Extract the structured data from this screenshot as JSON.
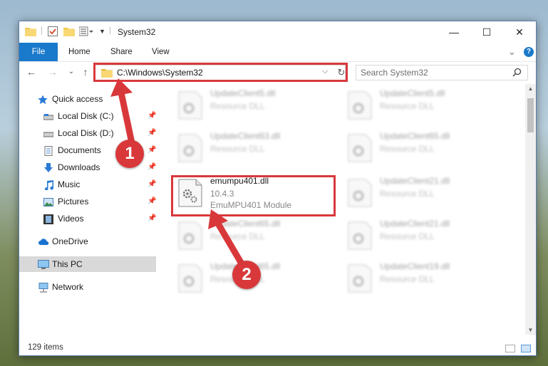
{
  "window": {
    "title": "System32",
    "controls": {
      "minimize": "—",
      "maximize": "☐",
      "close": "✕"
    }
  },
  "ribbon": {
    "tabs": [
      {
        "label": "File"
      },
      {
        "label": "Home"
      },
      {
        "label": "Share"
      },
      {
        "label": "View"
      }
    ],
    "expand_glyph": "⌄",
    "help_glyph": "?"
  },
  "nav": {
    "back": "←",
    "forward": "→",
    "recent": "⌄",
    "up": "↑",
    "address": "C:\\Windows\\System32",
    "address_drop": "⌵",
    "refresh": "↻",
    "search_placeholder": "Search System32"
  },
  "sidebar": {
    "items": [
      {
        "label": "Quick access",
        "icon": "star-icon",
        "pinned": false
      },
      {
        "label": "Local Disk (C:)",
        "icon": "drive-icon",
        "pinned": true
      },
      {
        "label": "Local Disk (D:)",
        "icon": "drive-icon",
        "pinned": true
      },
      {
        "label": "Documents",
        "icon": "documents-icon",
        "pinned": true
      },
      {
        "label": "Downloads",
        "icon": "download-arrow-icon",
        "pinned": true
      },
      {
        "label": "Music",
        "icon": "music-note-icon",
        "pinned": true
      },
      {
        "label": "Pictures",
        "icon": "pictures-icon",
        "pinned": true
      },
      {
        "label": "Videos",
        "icon": "film-icon",
        "pinned": true
      },
      {
        "label": "OneDrive",
        "icon": "cloud-icon",
        "pinned": false
      },
      {
        "label": "This PC",
        "icon": "computer-icon",
        "pinned": false,
        "selected": true
      },
      {
        "label": "Network",
        "icon": "network-icon",
        "pinned": false
      }
    ],
    "pin_glyph": "📌"
  },
  "files": [
    {
      "name": "UpdateClient5.dll",
      "type": "Resource DLL"
    },
    {
      "name": "UpdateClient5.dll",
      "type": "Resource DLL"
    },
    {
      "name": "UpdateClient63.dll",
      "type": "Resource DLL"
    },
    {
      "name": "UpdateClient65.dll",
      "type": "Resource DLL"
    },
    {
      "name": "emumpu401.dll",
      "type": "10.4.3",
      "module": "EmuMPU401 Module",
      "highlighted": true
    },
    {
      "name": "UpdateClient21.dll",
      "type": "Resource DLL"
    },
    {
      "name": "UpdateClient65.dll",
      "type": "Resource DLL"
    },
    {
      "name": "UpdateClient21.dll",
      "type": "Resource DLL"
    },
    {
      "name": "UpdateClient65.dll",
      "type": "Resource DLL"
    },
    {
      "name": "UpdateClient19.dll",
      "type": "Resource DLL"
    }
  ],
  "status": {
    "count": "129 items"
  },
  "callouts": [
    {
      "label": "1"
    },
    {
      "label": "2"
    }
  ],
  "colors": {
    "accent": "#1979ca",
    "highlight": "#d9383b",
    "selected_bg": "#d9d9d9"
  }
}
